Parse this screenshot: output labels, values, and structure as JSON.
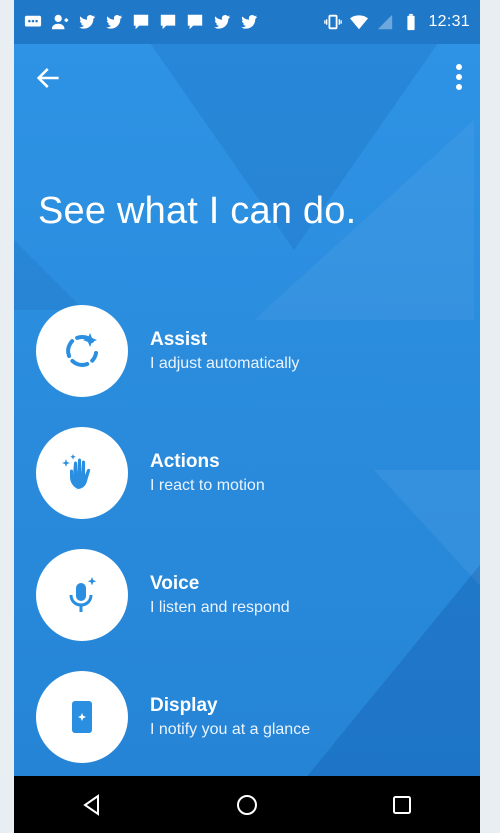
{
  "statusbar": {
    "time": "12:31",
    "icons": [
      "message-icon",
      "person-add-icon",
      "twitter-icon",
      "twitter-icon",
      "comment-icon",
      "comment-icon",
      "comment-icon",
      "twitter-icon",
      "twitter-icon",
      "vibrate-icon",
      "wifi-icon",
      "signal-icon",
      "battery-icon"
    ]
  },
  "appbar": {
    "back_icon": "arrow-back-icon",
    "menu_icon": "more-vert-icon"
  },
  "main": {
    "title": "See what I can do.",
    "features": [
      {
        "icon": "assist-icon",
        "title": "Assist",
        "subtitle": "I adjust automatically"
      },
      {
        "icon": "hand-wave-icon",
        "title": "Actions",
        "subtitle": "I react to motion"
      },
      {
        "icon": "microphone-icon",
        "title": "Voice",
        "subtitle": "I listen and respond"
      },
      {
        "icon": "phone-display-icon",
        "title": "Display",
        "subtitle": "I notify you at a glance"
      }
    ]
  },
  "navbar": {
    "back": "nav-back-icon",
    "home": "nav-home-icon",
    "recents": "nav-recents-icon"
  },
  "colors": {
    "background": "#2a8fe0",
    "statusbar": "#1f78c8",
    "icon_blue": "#2a8fe0",
    "navbar": "#000000"
  }
}
